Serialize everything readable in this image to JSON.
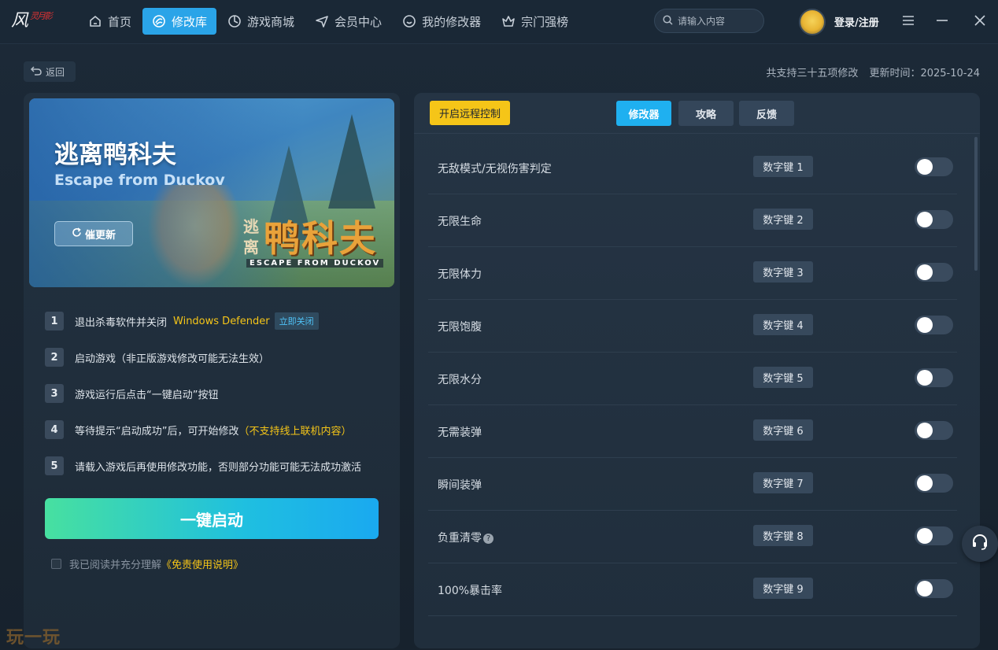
{
  "app": {
    "logo_text": "风",
    "logo_sub": "灵月影"
  },
  "nav": [
    {
      "label": "首页",
      "icon": "home-icon"
    },
    {
      "label": "修改库",
      "icon": "mod-library-icon",
      "active": true
    },
    {
      "label": "游戏商城",
      "icon": "game-store-icon"
    },
    {
      "label": "会员中心",
      "icon": "member-icon"
    },
    {
      "label": "我的修改器",
      "icon": "my-trainer-icon"
    },
    {
      "label": "宗门强榜",
      "icon": "crown-icon"
    }
  ],
  "search": {
    "placeholder": "请输入内容"
  },
  "user": {
    "login_label": "登录/注册"
  },
  "subheader": {
    "back_label": "返回",
    "support_count": "共支持三十五项修改",
    "update_time": "更新时间：2025-10-24"
  },
  "game": {
    "title_cn": "逃离鸭科夫",
    "title_en": "Escape from Duckov",
    "update_btn": "催更新",
    "art_small": "逃离",
    "art_big": "鸭科夫",
    "art_en": "ESCAPE FROM DUCKOV"
  },
  "steps": [
    {
      "num": "1",
      "text": "退出杀毒软件并关闭",
      "highlight": "Windows Defender",
      "action": "立即关闭"
    },
    {
      "num": "2",
      "text": "启动游戏（非正版游戏修改可能无法生效）"
    },
    {
      "num": "3",
      "text": "游戏运行后点击“一键启动”按钮"
    },
    {
      "num": "4",
      "text": "等待提示“启动成功”后，可开始修改",
      "note": "（不支持线上联机内容）"
    },
    {
      "num": "5",
      "text": "请载入游戏后再使用修改功能，否则部分功能可能无法成功激活"
    }
  ],
  "launch": {
    "label": "一键启动"
  },
  "agree": {
    "text": "我已阅读并充分理解",
    "link": "《免责使用说明》"
  },
  "watermark": "玩一玩",
  "right": {
    "remote_btn": "开启远程控制",
    "tabs": [
      "修改器",
      "攻略",
      "反馈"
    ],
    "active_tab": "修改器"
  },
  "cheats": [
    {
      "label": "无敌模式/无视伤害判定",
      "key": "数字键 1",
      "enabled": false
    },
    {
      "label": "无限生命",
      "key": "数字键 2",
      "enabled": false
    },
    {
      "label": "无限体力",
      "key": "数字键 3",
      "enabled": false
    },
    {
      "label": "无限饱腹",
      "key": "数字键 4",
      "enabled": false
    },
    {
      "label": "无限水分",
      "key": "数字键 5",
      "enabled": false
    },
    {
      "label": "无需装弹",
      "key": "数字键 6",
      "enabled": false
    },
    {
      "label": "瞬间装弹",
      "key": "数字键 7",
      "enabled": false
    },
    {
      "label": "负重清零",
      "key": "数字键 8",
      "enabled": false,
      "has_help": true
    },
    {
      "label": "100%暴击率",
      "key": "数字键 9",
      "enabled": false
    }
  ],
  "colors": {
    "accent": "#2aa4e8",
    "yellow": "#f5c518",
    "launch_start": "#47e0a0",
    "launch_end": "#1aa9f0"
  }
}
